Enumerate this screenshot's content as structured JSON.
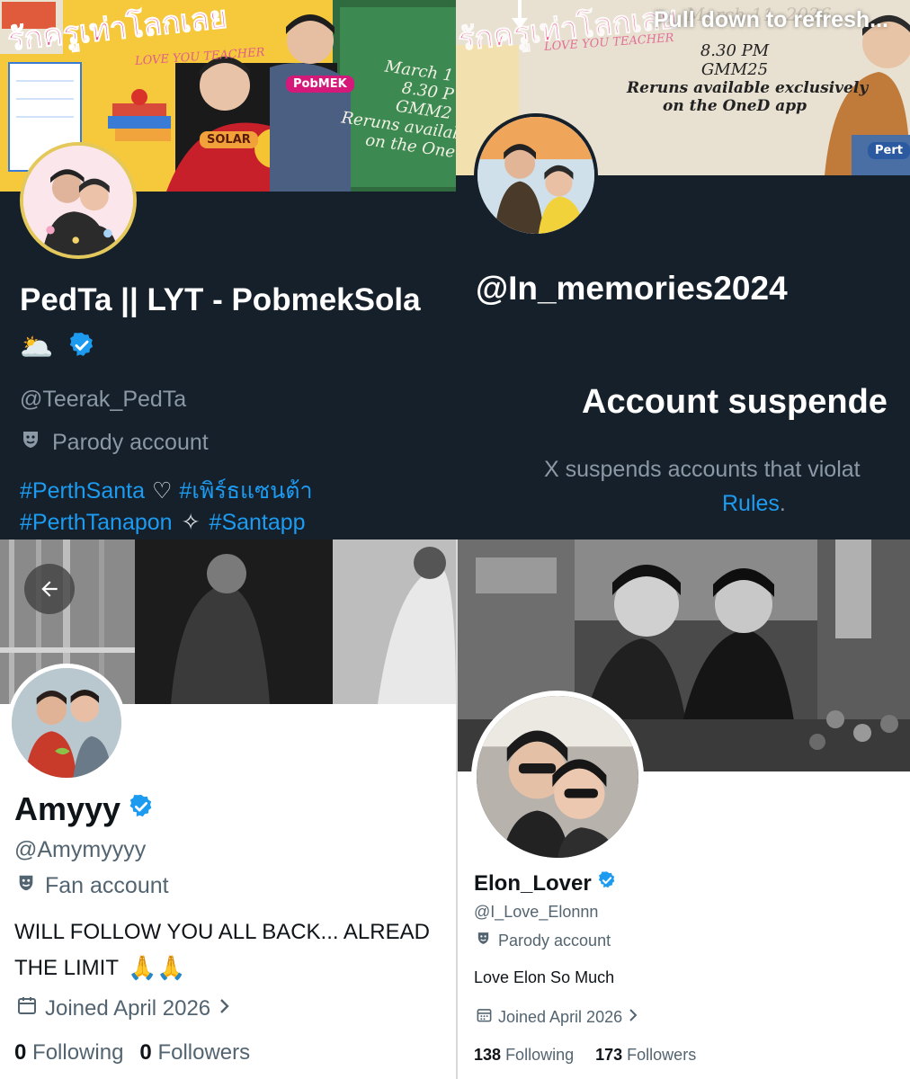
{
  "top_left": {
    "banner": {
      "title_thai": "รักครูเท่าโลกเลย",
      "title_en": "LOVE YOU TEACHER",
      "tag_a": "PobMEK",
      "tag_b": "SOLAR",
      "lines": [
        "March 1",
        "8.30 P",
        "GMM2",
        "Reruns available",
        "on the One"
      ]
    },
    "display_name": "PedTa || LYT - PobmekSola",
    "emoji_row": "🌥️",
    "handle": "@Teerak_PedTa",
    "label_icon": "theater-masks-icon",
    "label": "Parody account",
    "bio_line1": {
      "tag1": "#PerthSanta",
      "sep": "♡",
      "tag2": "#เพิร์ธแซนต้า"
    },
    "bio_line2": {
      "tag1": "#PerthTanapon",
      "sep": "✧",
      "tag2": "#Santapp"
    }
  },
  "top_right": {
    "refresh_text": "Pull down to refresh...",
    "banner": {
      "title_thai": "รักครูเท่าโลกเลย",
      "title_en": "LOVE YOU TEACHER",
      "date_text": "March 11, 2026",
      "lines": [
        "8.30 PM",
        "GMM25",
        "Reruns available exclusively",
        "on the OneD app"
      ],
      "tag": "Pert"
    },
    "handle": "@In_memories2024",
    "suspended_title": "Account suspende",
    "suspended_text_1": "X suspends accounts that violat",
    "suspended_link": "Rules",
    "suspended_end": "."
  },
  "bottom_left": {
    "display_name": "Amyyy",
    "handle": "@Amymyyyy",
    "label": "Fan account",
    "bio_1": "WILL FOLLOW YOU ALL BACK... ALREAD",
    "bio_2": "THE LIMIT",
    "bio_emoji": "🙏🙏",
    "joined": "Joined April 2026",
    "following_count": "0",
    "following_label": "Following",
    "followers_count": "0",
    "followers_label": "Followers"
  },
  "bottom_right": {
    "display_name": "Elon_Lover",
    "handle": "@I_Love_Elonnn",
    "label": "Parody account",
    "bio": "Love Elon So Much",
    "joined": "Joined April 2026",
    "following_count": "138",
    "following_label": "Following",
    "followers_count": "173",
    "followers_label": "Followers"
  },
  "colors": {
    "dark_bg": "#15202b",
    "accent_blue": "#1d9bf0",
    "muted_dark": "#8b98a5",
    "muted_light": "#536471"
  }
}
